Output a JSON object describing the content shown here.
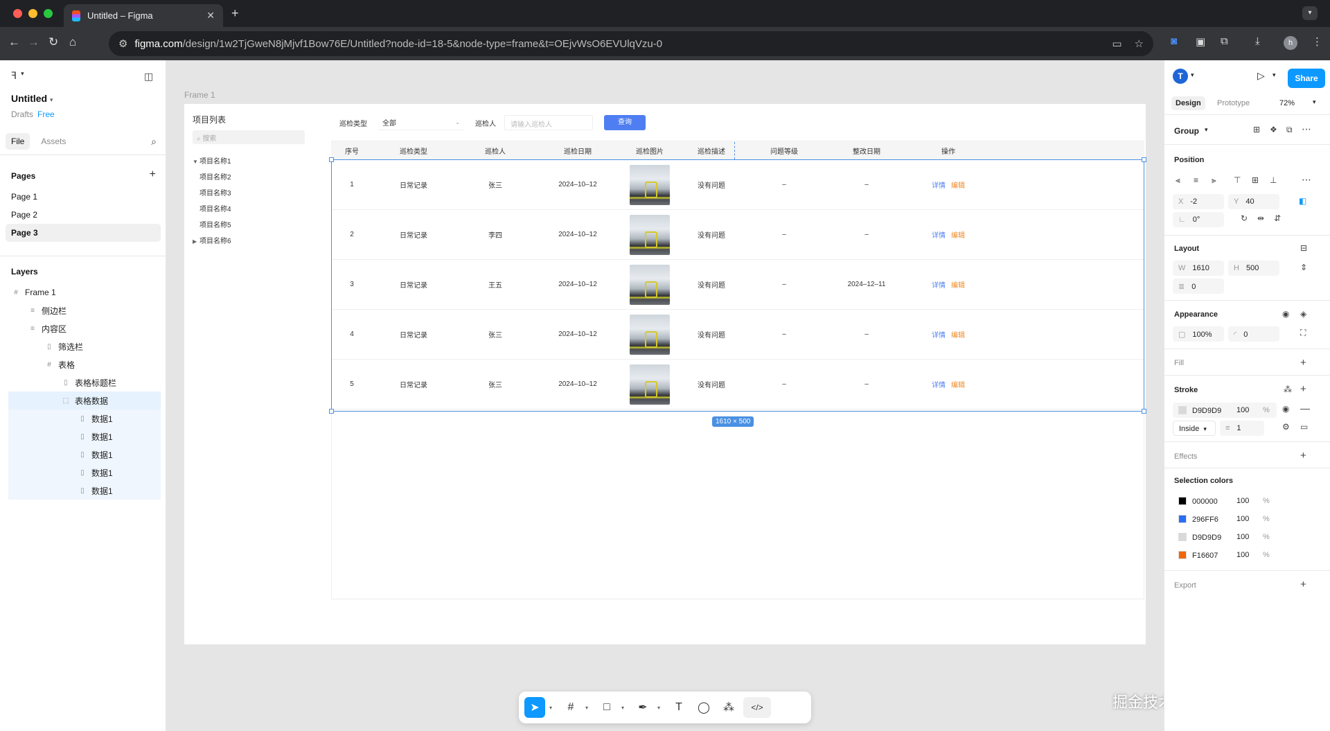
{
  "browser": {
    "tab_title": "Untitled – Figma",
    "tab_close": "✕",
    "new_tab": "+",
    "url_host": "figma.com",
    "url_path": "/design/1w2TjGweN8jMjvf1Bow76E/Untitled?node-id=18-5&node-type=frame&t=OEjvWsO6EVUlqVzu-0",
    "profile_initial": "h"
  },
  "left_panel": {
    "file_name": "Untitled",
    "drafts": "Drafts",
    "plan": "Free",
    "tab_file": "File",
    "tab_assets": "Assets",
    "pages_title": "Pages",
    "pages": [
      "Page 1",
      "Page 2",
      "Page 3"
    ],
    "layers_title": "Layers",
    "layers": [
      {
        "name": "Frame 1",
        "icon": "#"
      },
      {
        "name": "侧边栏",
        "icon": "≡"
      },
      {
        "name": "内容区",
        "icon": "≡"
      },
      {
        "name": "筛选栏",
        "icon": "▯"
      },
      {
        "name": "表格",
        "icon": "#"
      },
      {
        "name": "表格标题栏",
        "icon": "▯"
      },
      {
        "name": "表格数据",
        "icon": "⬚"
      },
      {
        "name": "数据1",
        "icon": "▯"
      },
      {
        "name": "数据1",
        "icon": "▯"
      },
      {
        "name": "数据1",
        "icon": "▯"
      },
      {
        "name": "数据1",
        "icon": "▯"
      },
      {
        "name": "数据1",
        "icon": "▯"
      }
    ]
  },
  "canvas": {
    "frame_label": "Frame 1",
    "sidebar": {
      "title": "项目列表",
      "search_placeholder": "搜索",
      "items": [
        "项目名称1",
        "项目名称2",
        "项目名称3",
        "项目名称4",
        "项目名称5",
        "项目名称6"
      ]
    },
    "filter": {
      "type_label": "巡检类型",
      "type_value": "全部",
      "inspector_label": "巡检人",
      "inspector_placeholder": "请输入巡检人",
      "query_button": "查询"
    },
    "table": {
      "headers": [
        "序号",
        "巡检类型",
        "巡检人",
        "巡检日期",
        "巡检图片",
        "巡检描述",
        "问题等级",
        "整改日期",
        "操作"
      ],
      "rows": [
        {
          "no": "1",
          "type": "日常记录",
          "person": "张三",
          "date": "2024–10–12",
          "desc": "没有问题",
          "level": "–",
          "fix_date": "–"
        },
        {
          "no": "2",
          "type": "日常记录",
          "person": "李四",
          "date": "2024–10–12",
          "desc": "没有问题",
          "level": "–",
          "fix_date": "–"
        },
        {
          "no": "3",
          "type": "日常记录",
          "person": "王五",
          "date": "2024–10–12",
          "desc": "没有问题",
          "level": "–",
          "fix_date": "2024–12–11"
        },
        {
          "no": "4",
          "type": "日常记录",
          "person": "张三",
          "date": "2024–10–12",
          "desc": "没有问题",
          "level": "–",
          "fix_date": "–"
        },
        {
          "no": "5",
          "type": "日常记录",
          "person": "张三",
          "date": "2024–10–12",
          "desc": "没有问题",
          "level": "–",
          "fix_date": "–"
        }
      ],
      "action_detail": "详情",
      "action_edit": "编辑"
    },
    "selection_size": "1610 × 500"
  },
  "right_panel": {
    "user_initial": "T",
    "share": "Share",
    "tab_design": "Design",
    "tab_prototype": "Prototype",
    "zoom": "72%",
    "selection_type": "Group",
    "position_title": "Position",
    "x_label": "X",
    "x_value": "-2",
    "y_label": "Y",
    "y_value": "40",
    "rotation": "0°",
    "layout_title": "Layout",
    "w_label": "W",
    "w_value": "1610",
    "h_label": "H",
    "h_value": "500",
    "gap_value": "0",
    "appearance_title": "Appearance",
    "opacity": "100%",
    "radius": "0",
    "fill_title": "Fill",
    "stroke_title": "Stroke",
    "stroke_color": "D9D9D9",
    "stroke_opacity": "100",
    "stroke_position": "Inside",
    "stroke_weight": "1",
    "effects_title": "Effects",
    "selection_colors_title": "Selection colors",
    "selection_colors": [
      {
        "hex": "000000",
        "opacity": "100",
        "swatch": "#000000"
      },
      {
        "hex": "296FF6",
        "opacity": "100",
        "swatch": "#296FF6"
      },
      {
        "hex": "D9D9D9",
        "opacity": "100",
        "swatch": "#D9D9D9"
      },
      {
        "hex": "F16607",
        "opacity": "100",
        "swatch": "#F16607"
      }
    ],
    "percent": "%",
    "export_title": "Export"
  },
  "watermark": "掘金技术社区 @ 我码玄黄",
  "colors": {
    "accent": "#0d99ff",
    "selection": "#4a90e2",
    "query_button": "#4e7ef2"
  }
}
